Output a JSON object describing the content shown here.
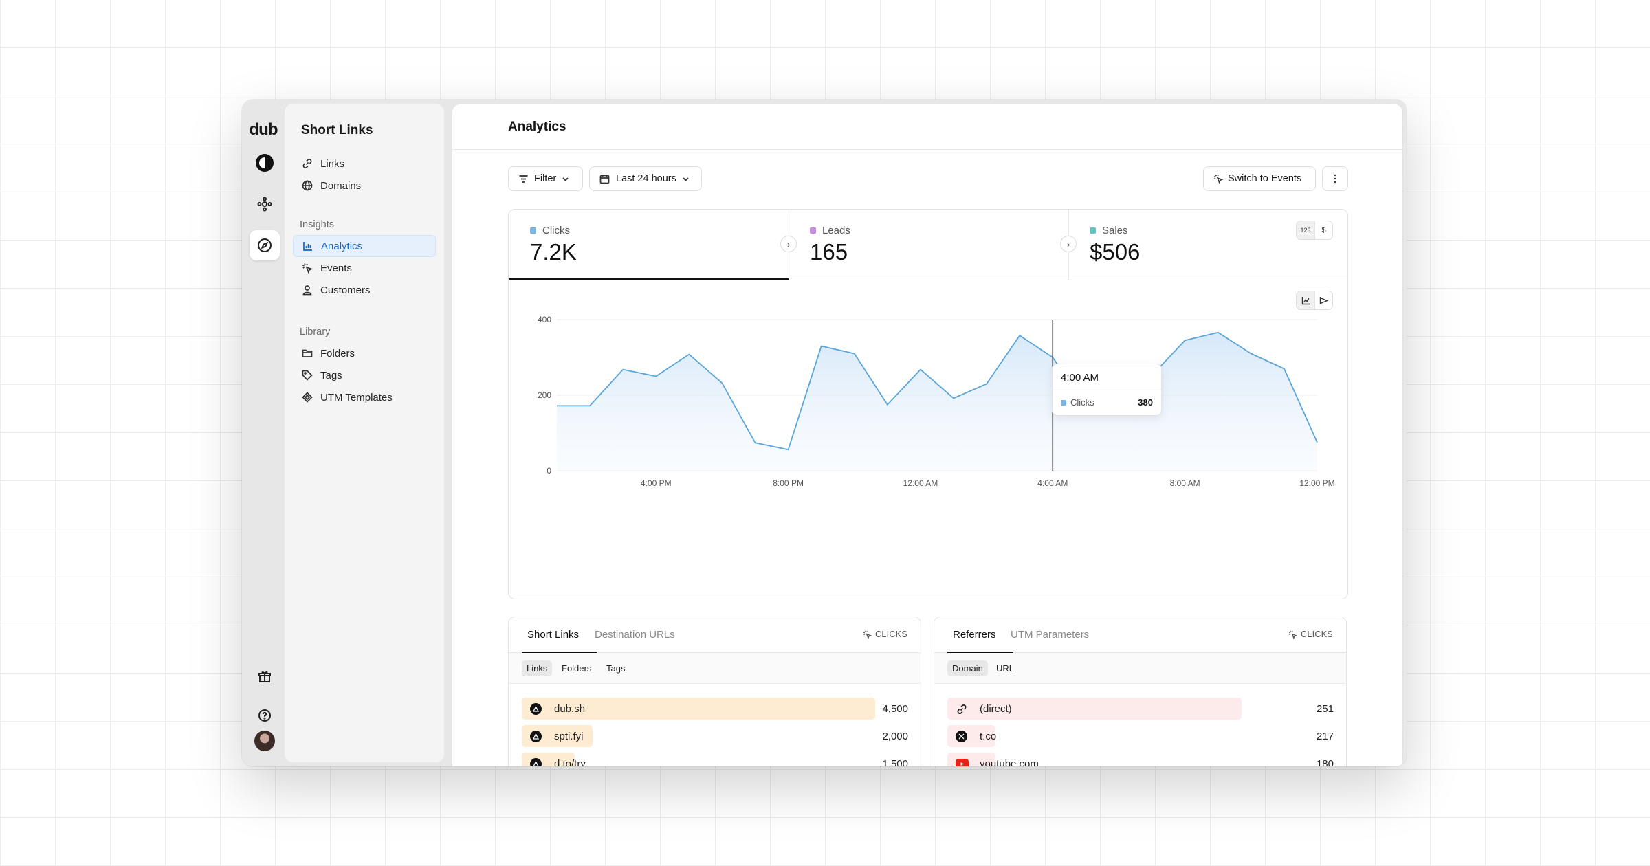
{
  "rail": {
    "logo": "dub",
    "icons": [
      "dub-circle-icon",
      "connections-icon",
      "compass-icon",
      "gift-icon",
      "help-icon"
    ]
  },
  "sidebar": {
    "title": "Short Links",
    "items": [
      {
        "label": "Links",
        "icon": "link-icon"
      },
      {
        "label": "Domains",
        "icon": "globe-icon"
      }
    ],
    "insights_label": "Insights",
    "insights": [
      {
        "label": "Analytics",
        "icon": "bar-chart-icon",
        "active": true
      },
      {
        "label": "Events",
        "icon": "cursor-rays-icon"
      },
      {
        "label": "Customers",
        "icon": "user-icon"
      }
    ],
    "library_label": "Library",
    "library": [
      {
        "label": "Folders",
        "icon": "folder-icon"
      },
      {
        "label": "Tags",
        "icon": "tag-icon"
      },
      {
        "label": "UTM Templates",
        "icon": "diamond-icon"
      }
    ]
  },
  "header": {
    "title": "Analytics"
  },
  "toolbar": {
    "filter_label": "Filter",
    "date_range_label": "Last 24 hours",
    "switch_label": "Switch to Events"
  },
  "metrics": [
    {
      "label": "Clicks",
      "value": "7.2K",
      "color": "#76b5e6"
    },
    {
      "label": "Leads",
      "value": "165",
      "color": "#c48ee0"
    },
    {
      "label": "Sales",
      "value": "$506",
      "color": "#5fc4c4"
    }
  ],
  "sales_toggle": {
    "count": "123",
    "currency": "$"
  },
  "tooltip": {
    "time": "4:00 AM",
    "label": "Clicks",
    "value": "380"
  },
  "chart_data": {
    "type": "area",
    "y_ticks": [
      "400",
      "200",
      "0"
    ],
    "x_tick_labels": [
      "4:00 PM",
      "8:00 PM",
      "12:00 AM",
      "4:00 AM",
      "8:00 AM",
      "12:00 PM"
    ],
    "ylim": [
      0,
      400
    ],
    "series": [
      {
        "name": "Clicks",
        "color": "#5aa5d9",
        "values": [
          172,
          172,
          268,
          250,
          308,
          232,
          74,
          56,
          330,
          310,
          175,
          268,
          192,
          230,
          358,
          300,
          172,
          172,
          252,
          345,
          366,
          310,
          270,
          75
        ]
      }
    ],
    "highlight_index": 15,
    "grid": true
  },
  "panels": {
    "left": {
      "tabs": [
        "Short Links",
        "Destination URLs"
      ],
      "clicks_label": "CLICKS",
      "subtabs": [
        "Links",
        "Folders",
        "Tags"
      ],
      "rows": [
        {
          "name": "dub.sh",
          "value": "4,500",
          "share": 1.0
        },
        {
          "name": "spti.fyi",
          "value": "2,000",
          "share": 0.2
        },
        {
          "name": "d.to/try",
          "value": "1,500",
          "share": 0.15
        }
      ]
    },
    "right": {
      "tabs": [
        "Referrers",
        "UTM Parameters"
      ],
      "clicks_label": "CLICKS",
      "subtabs": [
        "Domain",
        "URL"
      ],
      "rows": [
        {
          "name": "(direct)",
          "value": "251",
          "share": 1.0,
          "icon": "link-icon"
        },
        {
          "name": "t.co",
          "value": "217",
          "share": 0.16,
          "icon": "x-logo-icon"
        },
        {
          "name": "youtube.com",
          "value": "180",
          "share": 0.1,
          "icon": "youtube-icon"
        }
      ]
    }
  }
}
